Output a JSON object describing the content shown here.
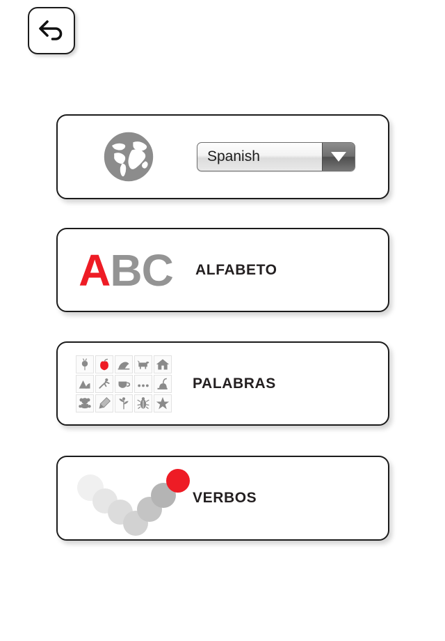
{
  "nav": {
    "back_button": {
      "name": "back-button",
      "icon": "back-arrow-icon"
    }
  },
  "language_card": {
    "globe_icon": "globe-icon",
    "selected_language": "Spanish",
    "dropdown_icon": "chevron-down-icon"
  },
  "menu": [
    {
      "id": "alphabet",
      "label": "ALFABETO",
      "icon": "abc-icon",
      "abc": {
        "first": "A",
        "rest": "BC",
        "first_color": "#ee1c25",
        "rest_color": "#949494"
      }
    },
    {
      "id": "words",
      "label": "PALABRAS",
      "icon": "word-grid-icon",
      "tiles": [
        "beet-icon",
        "apple-icon",
        "seal-icon",
        "cow-icon",
        "house-icon",
        "mountain-icon",
        "runner-icon",
        "cup-icon",
        "ellipsis-icon",
        "vacuum-icon",
        "teddy-bear-icon",
        "pen-icon",
        "plant-icon",
        "beetle-icon",
        "starfish-icon"
      ],
      "highlight_tile": "apple-icon",
      "highlight_color": "#ee1c25"
    },
    {
      "id": "verbs",
      "label": "VERBOS",
      "icon": "v-dots-icon",
      "dots": [
        {
          "color": "#f0f0f0"
        },
        {
          "color": "#e6e6e6"
        },
        {
          "color": "#dcdcdc"
        },
        {
          "color": "#d2d2d2"
        },
        {
          "color": "#c4c4c4"
        },
        {
          "color": "#b4b4b4"
        },
        {
          "color": "#ee1c25"
        }
      ]
    }
  ],
  "theme": {
    "accent": "#ee1c25",
    "gray": "#949494",
    "border": "#1b1b1b",
    "background": "#ffffff"
  }
}
